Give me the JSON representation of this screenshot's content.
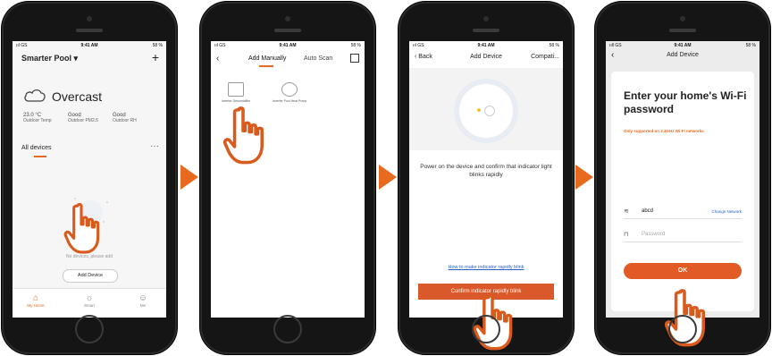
{
  "status": {
    "carrier": "ııl GS",
    "carrier4": "ııll GS",
    "time": "9:41 AM",
    "battery": "58 %"
  },
  "screen1": {
    "home_name": "Smarter Pool",
    "weather": "Overcast",
    "stats": [
      {
        "value": "23.0 °C",
        "label": "Outdoor Temp"
      },
      {
        "value": "Good",
        "label": "Outdoor PM2.5"
      },
      {
        "value": "Good",
        "label": "Outdoor RH"
      }
    ],
    "all_devices": "All devices",
    "no_devices": "No devices, please add",
    "add_device": "Add Device",
    "tabs": [
      {
        "label": "My Home"
      },
      {
        "label": "Smart"
      },
      {
        "label": "Me"
      }
    ]
  },
  "screen2": {
    "tab_manual": "Add Manually",
    "tab_auto": "Auto Scan",
    "devices": [
      {
        "label": "Inverter Dehumidifier"
      },
      {
        "label": "Inverter Pool Heat Pump"
      }
    ]
  },
  "screen3": {
    "back": "Back",
    "title": "Add Device",
    "right": "Compati...",
    "instruction": "Power on the device and confirm that indicator light blinks rapidly",
    "link": "How to make indicator rapidly blink",
    "confirm": "Confirm indicator rapidly blink"
  },
  "screen4": {
    "title": "Add Device",
    "heading": "Enter your home's Wi-Fi password",
    "note": "Only supported on 2.4GHz Wi-Fi networks",
    "ssid": "abcd",
    "change_network": "Change Network",
    "password_placeholder": "Password",
    "ok": "OK"
  },
  "colors": {
    "accent": "#e86a1e",
    "link": "#2a5fc9"
  }
}
